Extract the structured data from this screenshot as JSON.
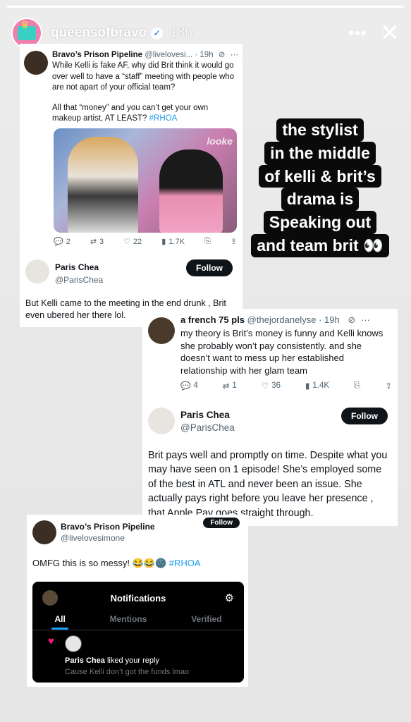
{
  "story": {
    "username": "queensofbravo",
    "time": "18h",
    "progress": 1.0,
    "icons": {
      "verified": "verified-check-icon",
      "more": "more-icon",
      "close": "close-icon"
    }
  },
  "tweet1": {
    "name": "Bravo’s Prison Pipeline",
    "handle": "@livelovesi...",
    "time": "· 19h",
    "text_line1": "While Kelli is fake AF, why did Brit think it would go over well to have a “staff” meeting with people who are not apart of your official team?",
    "text_line2": "All that “money” and you can’t get your own makeup artist, AT LEAST?",
    "hashtag": "#RHOA",
    "image_label": "looke",
    "stats": {
      "replies": "2",
      "retweets": "3",
      "likes": "22",
      "views": "1.7K"
    }
  },
  "reply1": {
    "name": "Paris Chea",
    "handle": "@ParisChea",
    "follow_label": "Follow",
    "text": "But Kelli came to the meeting in the end drunk , Brit even ubered her there lol."
  },
  "sticker": {
    "lines": [
      "the stylist",
      "in the middle",
      "of kelli & brit’s",
      "drama is",
      "Speaking out",
      "and team brit 👀"
    ]
  },
  "tweet2": {
    "name": "a french 75 pls",
    "handle": "@thejordanelyse",
    "time": "· 19h",
    "text": "my theory is Brit’s money is funny and Kelli knows she probably won’t pay consistently. and she doesn’t want to mess up her established relationship with her glam team",
    "stats": {
      "replies": "4",
      "retweets": "1",
      "likes": "36",
      "views": "1.4K"
    }
  },
  "reply2": {
    "name": "Paris Chea",
    "handle": "@ParisChea",
    "follow_label": "Follow",
    "text": "Brit pays well and promptly on time. Despite what you may have seen on 1 episode! She’s employed some of the best in ATL and never been an issue. She actually pays right before you leave her presence , that Apple Pay goes straight through."
  },
  "tweet3": {
    "name": "Bravo’s Prison Pipeline",
    "handle": "@livelovesimone",
    "follow_label": "Follow",
    "text": "OMFG this is so messy! 😂😂🌚",
    "hashtag": "#RHOA",
    "notifications": {
      "title": "Notifications",
      "tabs": [
        "All",
        "Mentions",
        "Verified"
      ],
      "liker": "Paris Chea",
      "action": "liked your reply",
      "reply_preview": "Cause Kelli don’t got the funds lmao"
    }
  }
}
